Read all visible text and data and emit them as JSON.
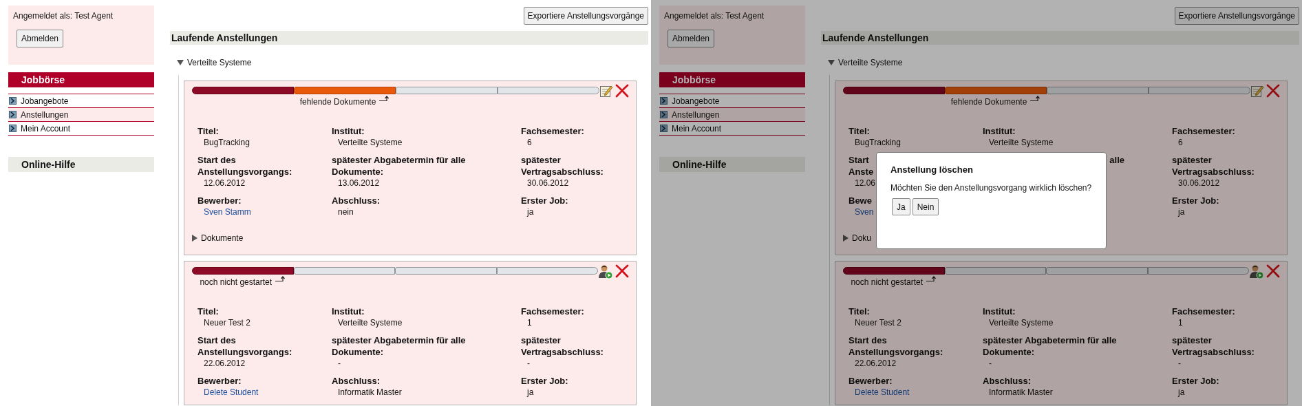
{
  "screens": [
    {
      "sidebar": {
        "login_text": "Angemeldet als: Test Agent",
        "logout_button": "Abmelden",
        "nav_title": "Jobbörse",
        "nav_items": [
          {
            "label": "Jobangebote",
            "selected": false
          },
          {
            "label": "Anstellungen",
            "selected": true
          },
          {
            "label": "Mein Account",
            "selected": false
          }
        ],
        "help_title": "Online-Hilfe"
      },
      "export_button": "Exportiere Anstellungsvorgänge",
      "section_title": "Laufende Anstellungen",
      "group": {
        "label": "Verteilte Systeme",
        "expanded": true,
        "cards": [
          {
            "progress": [
              {
                "done": true,
                "current": false
              },
              {
                "done": false,
                "current": true
              },
              {
                "done": false,
                "current": false
              },
              {
                "done": false,
                "current": false
              }
            ],
            "status": "fehlende Dokumente",
            "actions": [
              {
                "kind": "edit"
              },
              {
                "kind": "delete"
              }
            ],
            "rows": [
              [
                {
                  "label": "Titel:",
                  "value": "BugTracking",
                  "link": false
                },
                {
                  "label": "Institut:",
                  "value": "Verteilte Systeme",
                  "link": false
                },
                {
                  "label": "Fachsemester:",
                  "value": "6",
                  "link": false
                }
              ],
              [
                {
                  "label": "Start des Anstellungsvorgangs:",
                  "value": "12.06.2012",
                  "link": false
                },
                {
                  "label": "spätester Abgabetermin für alle Dokumente:",
                  "value": "13.06.2012",
                  "link": false
                },
                {
                  "label": "spätester Vertragsabschluss:",
                  "value": "30.06.2012",
                  "link": false
                }
              ],
              [
                {
                  "label": "Bewerber:",
                  "value": "Sven Stamm",
                  "link": true
                },
                {
                  "label": "Abschluss:",
                  "value": "nein",
                  "link": false
                },
                {
                  "label": "Erster Job:",
                  "value": "ja",
                  "link": false
                }
              ]
            ],
            "documents": {
              "label": "Dokumente",
              "expanded": false
            }
          },
          {
            "progress": [
              {
                "done": true,
                "current": false
              },
              {
                "done": false,
                "current": false
              },
              {
                "done": false,
                "current": false
              },
              {
                "done": false,
                "current": false
              }
            ],
            "status": "noch nicht gestartet",
            "actions": [
              {
                "kind": "start"
              },
              {
                "kind": "delete"
              }
            ],
            "rows": [
              [
                {
                  "label": "Titel:",
                  "value": "Neuer Test 2",
                  "link": false
                },
                {
                  "label": "Institut:",
                  "value": "Verteilte Systeme",
                  "link": false
                },
                {
                  "label": "Fachsemester:",
                  "value": "1",
                  "link": false
                }
              ],
              [
                {
                  "label": "Start des Anstellungsvorgangs:",
                  "value": "22.06.2012",
                  "link": false
                },
                {
                  "label": "spätester Abgabetermin für alle Dokumente:",
                  "value": "-",
                  "link": false
                },
                {
                  "label": "spätester Vertragsabschluss:",
                  "value": "-",
                  "link": false
                }
              ],
              [
                {
                  "label": "Bewerber:",
                  "value": "Delete Student",
                  "link": true
                },
                {
                  "label": "Abschluss:",
                  "value": "Informatik Master",
                  "link": false
                },
                {
                  "label": "Erster Job:",
                  "value": "ja",
                  "link": false
                }
              ]
            ]
          }
        ]
      }
    },
    {
      "sidebar": {
        "login_text": "Angemeldet als: Test Agent",
        "logout_button": "Abmelden",
        "nav_title": "Jobbörse",
        "nav_items": [
          {
            "label": "Jobangebote",
            "selected": false
          },
          {
            "label": "Anstellungen",
            "selected": true
          },
          {
            "label": "Mein Account",
            "selected": false
          }
        ],
        "help_title": "Online-Hilfe"
      },
      "export_button": "Exportiere Anstellungsvorgänge",
      "section_title": "Laufende Anstellungen",
      "group": {
        "label": "Verteilte Systeme",
        "expanded": true,
        "cards": [
          {
            "progress": [
              {
                "done": true,
                "current": false
              },
              {
                "done": false,
                "current": true
              },
              {
                "done": false,
                "current": false
              },
              {
                "done": false,
                "current": false
              }
            ],
            "status": "fehlende Dokumente",
            "actions": [
              {
                "kind": "edit"
              },
              {
                "kind": "delete"
              }
            ],
            "rows": [
              [
                {
                  "label": "Titel:",
                  "value": "BugTracking",
                  "link": false
                },
                {
                  "label": "Institut:",
                  "value": "Verteilte Systeme",
                  "link": false
                },
                {
                  "label": "Fachsemester:",
                  "value": "6",
                  "link": false
                }
              ],
              [
                {
                  "label": "Start\nAnste",
                  "value": "12.06",
                  "link": false
                },
                {
                  "label": "alle",
                  "covered_start": true
                },
                {
                  "label": "spätester Vertragsabschluss:",
                  "value": "30.06.2012",
                  "link": false
                }
              ],
              [
                {
                  "label": "Bewe",
                  "value": "Sven",
                  "link": true
                },
                null,
                {
                  "label": "Erster Job:",
                  "value": "ja",
                  "link": false
                }
              ]
            ],
            "documents": {
              "label": "Doku",
              "expanded": false
            }
          },
          {
            "progress": [
              {
                "done": true,
                "current": false
              },
              {
                "done": false,
                "current": false
              },
              {
                "done": false,
                "current": false
              },
              {
                "done": false,
                "current": false
              }
            ],
            "status": "noch nicht gestartet",
            "actions": [
              {
                "kind": "start"
              },
              {
                "kind": "delete"
              }
            ],
            "rows": [
              [
                {
                  "label": "Titel:",
                  "value": "Neuer Test 2",
                  "link": false
                },
                {
                  "label": "Institut:",
                  "value": "Verteilte Systeme",
                  "link": false
                },
                {
                  "label": "Fachsemester:",
                  "value": "1",
                  "link": false
                }
              ],
              [
                {
                  "label": "Start des Anstellungsvorgangs:",
                  "value": "22.06.2012",
                  "link": false
                },
                {
                  "label": "spätester Abgabetermin für alle Dokumente:",
                  "value": "-",
                  "link": false
                },
                {
                  "label": "spätester Vertragsabschluss:",
                  "value": "-",
                  "link": false
                }
              ],
              [
                {
                  "label": "Bewerber:",
                  "value": "Delete Student",
                  "link": true
                },
                {
                  "label": "Abschluss:",
                  "value": "Informatik Master",
                  "link": false
                },
                {
                  "label": "Erster Job:",
                  "value": "ja",
                  "link": false
                }
              ]
            ]
          }
        ]
      },
      "dialog": {
        "title": "Anstellung löschen",
        "message": "Möchten Sie den Anstellungsvorgang wirklich löschen?",
        "buttons": [
          "Ja",
          "Nein"
        ]
      }
    }
  ]
}
